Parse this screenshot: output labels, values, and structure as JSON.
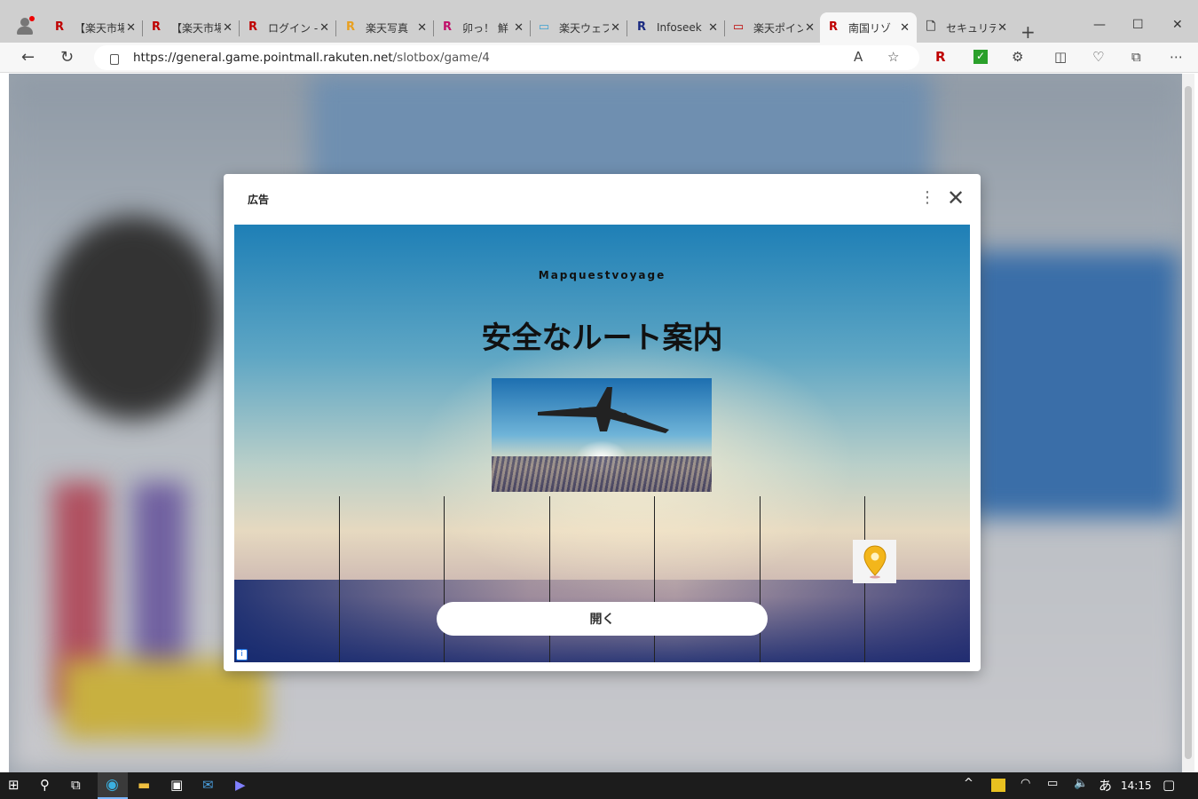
{
  "browser": {
    "tabs": [
      {
        "title": "【楽天市場",
        "favicon": "R",
        "color": "#bf0000"
      },
      {
        "title": "【楽天市場",
        "favicon": "R",
        "color": "#bf0000"
      },
      {
        "title": "ログイン - ",
        "favicon": "R",
        "color": "#bf0000"
      },
      {
        "title": "楽天写真",
        "favicon": "R",
        "color": "#e8a020"
      },
      {
        "title": "卯っ！ 鮮",
        "favicon": "R",
        "color": "#c0106a"
      },
      {
        "title": "楽天ウェブ",
        "favicon": "▭",
        "color": "#3aa0d0"
      },
      {
        "title": "Infoseek",
        "favicon": "R",
        "color": "#1a2a80"
      },
      {
        "title": "楽天ポイン",
        "favicon": "▭",
        "color": "#bf0000"
      },
      {
        "title": "南国リゾ",
        "favicon": "R",
        "color": "#bf0000",
        "active": true
      },
      {
        "title": "セキュリテ",
        "favicon": "🗋",
        "color": "#444"
      }
    ],
    "url_host": "https://general.game.pointmall.rakuten.net",
    "url_path": "/slotbox/game/4"
  },
  "modal": {
    "header": "広告",
    "ad": {
      "brand": "Mapquestvoyage",
      "headline": "安全なルート案内",
      "cta": "開く",
      "info": "i"
    }
  },
  "taskbar": {
    "ime": "あ",
    "time": "14:15"
  }
}
